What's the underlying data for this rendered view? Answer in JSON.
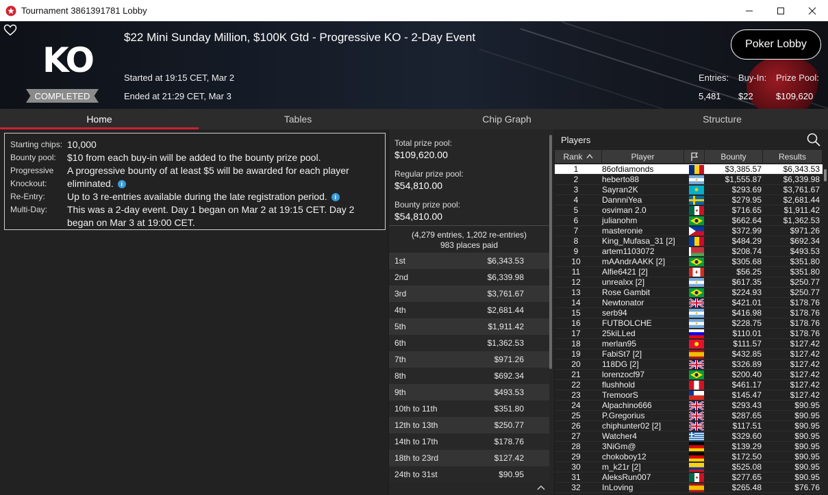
{
  "window": {
    "title": "Tournament 3861391781 Lobby",
    "controls": [
      "minimize",
      "maximize",
      "close"
    ]
  },
  "header": {
    "logo_text": "KO",
    "status": "COMPLETED",
    "title": "$22 Mini Sunday Million, $100K Gtd - Progressive KO - 2-Day Event",
    "started": "Started at 19:15 CET, Mar 2",
    "ended": "Ended at 21:29 CET, Mar 3",
    "lobby_button": "Poker Lobby",
    "stats": {
      "entries_label": "Entries:",
      "entries_value": "5,481",
      "buyin_label": "Buy-In:",
      "buyin_value": "$22",
      "prizepool_label": "Prize Pool:",
      "prizepool_value": "$109,620"
    }
  },
  "tabs": [
    {
      "label": "Home",
      "active": true
    },
    {
      "label": "Tables",
      "active": false
    },
    {
      "label": "Chip Graph",
      "active": false
    },
    {
      "label": "Structure",
      "active": false
    }
  ],
  "info": {
    "starting_chips_label": "Starting chips:",
    "starting_chips": "10,000",
    "bounty_pool_label": "Bounty pool:",
    "bounty_pool": "$10 from each buy-in will be added to the bounty prize pool.",
    "progressive_label": "Progressive Knockout:",
    "progressive": "A progressive bounty of at least $5 will be awarded for each player eliminated.",
    "reentry_label": "Re-Entry:",
    "reentry": "Up to 3 re-entries available during the late registration period.",
    "multiday_label": "Multi-Day:",
    "multiday": "This was a 2-day event. Day 1 began on Mar 2 at 19:15 CET. Day 2 began on Mar 3 at 19:00 CET."
  },
  "prizes": {
    "total_label": "Total prize pool:",
    "total": "$109,620.00",
    "regular_label": "Regular prize pool:",
    "regular": "$54,810.00",
    "bounty_label": "Bounty prize pool:",
    "bounty": "$54,810.00",
    "entries_line": "(4,279 entries, 1,202 re-entries)",
    "places_paid": "983 places paid",
    "rows": [
      {
        "place": "1st",
        "amount": "$6,343.53"
      },
      {
        "place": "2nd",
        "amount": "$6,339.98"
      },
      {
        "place": "3rd",
        "amount": "$3,761.67"
      },
      {
        "place": "4th",
        "amount": "$2,681.44"
      },
      {
        "place": "5th",
        "amount": "$1,911.42"
      },
      {
        "place": "6th",
        "amount": "$1,362.53"
      },
      {
        "place": "7th",
        "amount": "$971.26"
      },
      {
        "place": "8th",
        "amount": "$692.34"
      },
      {
        "place": "9th",
        "amount": "$493.53"
      },
      {
        "place": "10th to 11th",
        "amount": "$351.80"
      },
      {
        "place": "12th to 13th",
        "amount": "$250.77"
      },
      {
        "place": "14th to 17th",
        "amount": "$178.76"
      },
      {
        "place": "18th to 23rd",
        "amount": "$127.42"
      },
      {
        "place": "24th to 31st",
        "amount": "$90.95"
      }
    ]
  },
  "players": {
    "title": "Players",
    "columns": {
      "rank": "Rank",
      "player": "Player",
      "bounty": "Bounty",
      "results": "Results"
    },
    "rows": [
      {
        "rank": "1",
        "name": "86ofdiamonds",
        "flag": "romania",
        "bounty": "$3,385.57",
        "result": "$6,343.53"
      },
      {
        "rank": "2",
        "name": "heberto88",
        "flag": "argentina",
        "bounty": "$1,555.87",
        "result": "$6,339.98"
      },
      {
        "rank": "3",
        "name": "Sayran2K",
        "flag": "kazakhstan",
        "bounty": "$293.69",
        "result": "$3,761.67"
      },
      {
        "rank": "4",
        "name": "DannniYea",
        "flag": "sweden",
        "bounty": "$279.95",
        "result": "$2,681.44"
      },
      {
        "rank": "5",
        "name": "osviman 2.0",
        "flag": "mexico",
        "bounty": "$716.65",
        "result": "$1,911.42"
      },
      {
        "rank": "6",
        "name": "julianohm",
        "flag": "brazil",
        "bounty": "$662.64",
        "result": "$1,362.53"
      },
      {
        "rank": "7",
        "name": "masteronie",
        "flag": "philippines",
        "bounty": "$372.99",
        "result": "$971.26"
      },
      {
        "rank": "8",
        "name": "King_Mufasa_31 [2]",
        "flag": "moldova",
        "bounty": "$484.29",
        "result": "$692.34"
      },
      {
        "rank": "9",
        "name": "artem1103072",
        "flag": "belarus",
        "bounty": "$208.74",
        "result": "$493.53"
      },
      {
        "rank": "10",
        "name": "mAAndrAAKK [2]",
        "flag": "brazil",
        "bounty": "$305.68",
        "result": "$351.80"
      },
      {
        "rank": "11",
        "name": "Alfie6421 [2]",
        "flag": "canada",
        "bounty": "$56.25",
        "result": "$351.80"
      },
      {
        "rank": "12",
        "name": "unrealxx [2]",
        "flag": "argentina",
        "bounty": "$617.35",
        "result": "$250.77"
      },
      {
        "rank": "13",
        "name": "Rose Gambit",
        "flag": "brazil",
        "bounty": "$224.93",
        "result": "$250.77"
      },
      {
        "rank": "14",
        "name": "Newtonator",
        "flag": "uk",
        "bounty": "$421.01",
        "result": "$178.76"
      },
      {
        "rank": "15",
        "name": "serb94",
        "flag": "argentina",
        "bounty": "$416.98",
        "result": "$178.76"
      },
      {
        "rank": "16",
        "name": "FUTBOLCHE",
        "flag": "argentina",
        "bounty": "$228.75",
        "result": "$178.76"
      },
      {
        "rank": "17",
        "name": "25kiLLed",
        "flag": "slovenia",
        "bounty": "$110.01",
        "result": "$178.76"
      },
      {
        "rank": "18",
        "name": "merlan95",
        "flag": "kyrgyzstan",
        "bounty": "$111.57",
        "result": "$127.42"
      },
      {
        "rank": "19",
        "name": "FabiSt7 [2]",
        "flag": "spain",
        "bounty": "$432.85",
        "result": "$127.42"
      },
      {
        "rank": "20",
        "name": "118DG [2]",
        "flag": "uk",
        "bounty": "$326.89",
        "result": "$127.42"
      },
      {
        "rank": "21",
        "name": "lorenzocf97",
        "flag": "brazil",
        "bounty": "$200.40",
        "result": "$127.42"
      },
      {
        "rank": "22",
        "name": "flushhold",
        "flag": "peru",
        "bounty": "$461.17",
        "result": "$127.42"
      },
      {
        "rank": "23",
        "name": "TremoorS",
        "flag": "chile",
        "bounty": "$145.47",
        "result": "$127.42"
      },
      {
        "rank": "24",
        "name": "Alpachino666",
        "flag": "uk",
        "bounty": "$293.43",
        "result": "$90.95"
      },
      {
        "rank": "25",
        "name": "P.Gregorius",
        "flag": "uk",
        "bounty": "$287.65",
        "result": "$90.95"
      },
      {
        "rank": "26",
        "name": "chiphunter02 [2]",
        "flag": "uk",
        "bounty": "$117.51",
        "result": "$90.95"
      },
      {
        "rank": "27",
        "name": "Watcher4",
        "flag": "greece",
        "bounty": "$329.60",
        "result": "$90.95"
      },
      {
        "rank": "28",
        "name": "3NiGm@",
        "flag": "germany",
        "bounty": "$139.29",
        "result": "$90.95"
      },
      {
        "rank": "29",
        "name": "chokoboy12",
        "flag": "germany",
        "bounty": "$172.50",
        "result": "$90.95"
      },
      {
        "rank": "30",
        "name": "m_k21r [2]",
        "flag": "colombia",
        "bounty": "$525.08",
        "result": "$90.95"
      },
      {
        "rank": "31",
        "name": "AleksRun007",
        "flag": "mexico",
        "bounty": "$277.65",
        "result": "$90.95"
      },
      {
        "rank": "32",
        "name": "InLoving",
        "flag": "spain",
        "bounty": "$265.48",
        "result": "$76.76"
      }
    ]
  },
  "colors": {
    "accent": "#d0202f",
    "panel": "#222222",
    "header_bg": "#141821"
  }
}
